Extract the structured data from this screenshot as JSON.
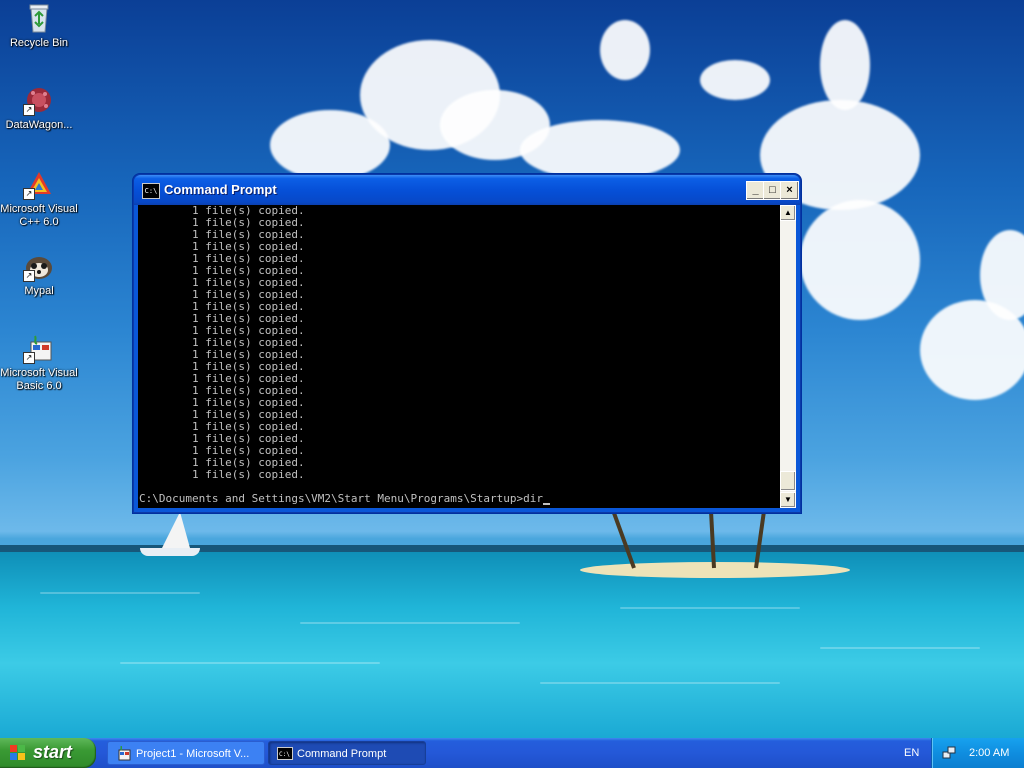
{
  "desktop": {
    "icons": [
      {
        "label": "Recycle Bin",
        "icon": "recycle-bin-icon"
      },
      {
        "label": "DataWagon...",
        "icon": "datawagon-icon"
      },
      {
        "label": "Microsoft Visual C++ 6.0",
        "icon": "visual-cpp-icon"
      },
      {
        "label": "Mypal",
        "icon": "mypal-icon"
      },
      {
        "label": "Microsoft Visual Basic 6.0",
        "icon": "visual-basic-icon"
      }
    ]
  },
  "window": {
    "title": "Command Prompt",
    "icon_text": "C:\\",
    "buttons": {
      "minimize": "_",
      "maximize": "□",
      "close": "×"
    },
    "output_lines": [
      "        1 file(s) copied.",
      "        1 file(s) copied.",
      "        1 file(s) copied.",
      "        1 file(s) copied.",
      "        1 file(s) copied.",
      "        1 file(s) copied.",
      "        1 file(s) copied.",
      "        1 file(s) copied.",
      "        1 file(s) copied.",
      "        1 file(s) copied.",
      "        1 file(s) copied.",
      "        1 file(s) copied.",
      "        1 file(s) copied.",
      "        1 file(s) copied.",
      "        1 file(s) copied.",
      "        1 file(s) copied.",
      "        1 file(s) copied.",
      "        1 file(s) copied.",
      "        1 file(s) copied.",
      "        1 file(s) copied.",
      "        1 file(s) copied.",
      "        1 file(s) copied.",
      "        1 file(s) copied."
    ],
    "prompt_line": "C:\\Documents and Settings\\VM2\\Start Menu\\Programs\\Startup>dir"
  },
  "taskbar": {
    "start_label": "start",
    "tasks": [
      {
        "label": "Project1 - Microsoft V...",
        "icon": "visual-basic-icon",
        "active": false
      },
      {
        "label": "Command Prompt",
        "icon": "command-prompt-icon",
        "active": true
      }
    ],
    "language": "EN",
    "clock": "2:00 AM"
  },
  "colors": {
    "titlebar": "#0650d8",
    "console_bg": "#000000",
    "console_text": "#c0c0c0",
    "start_button": "#3a9a34",
    "taskbar": "#245edc"
  }
}
